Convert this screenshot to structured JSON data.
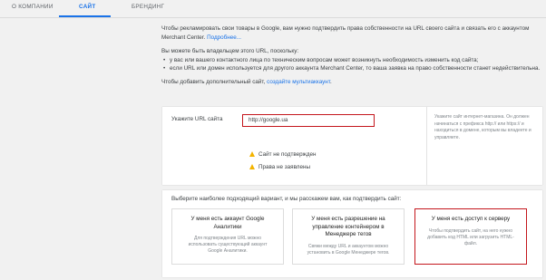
{
  "tabs": [
    {
      "label": "О КОМПАНИИ"
    },
    {
      "label": "САЙТ"
    },
    {
      "label": "БРЕНДИНГ"
    }
  ],
  "intro": {
    "line1": "Чтобы рекламировать свои товары в Google, вам нужно подтвердить права собственности на URL своего сайта и связать его с аккаунтом Merchant Center.",
    "line1_link": "Подробнее...",
    "line2": "Вы можете быть владельцем этого URL, поскольку:",
    "bullet1": "у вас или вашего контактного лица по техническим вопросам может возникнуть необходимость изменить код сайта;",
    "bullet2": "если URL или домен используется для другого аккаунта Merchant Center, то ваша заявка на право собственности станет недействительна.",
    "line3": "Чтобы добавить дополнительный сайт,",
    "line3_link": "создайте мультиаккаунт",
    "line3_end": "."
  },
  "url_card": {
    "label": "Укажите URL сайта",
    "value": "http://google.ua",
    "help": "Укажите сайт интернет-магазина. Он должен начинаться с префикса http:// или https:// и находиться в домене, которым вы владеете и управляете.",
    "status1": "Сайт не подтвержден",
    "status2": "Права не заявлены",
    "warning_color": "#f4b400"
  },
  "verify_card": {
    "prompt": "Выберите наиболее подходящий вариант, и мы расскажем вам, как подтвердить сайт:",
    "options": [
      {
        "title": "У меня есть аккаунт Google Аналитики",
        "desc": "Для подтверждения URL можно использовать существующий аккаунт Google Аналитики."
      },
      {
        "title": "У меня есть разрешение на управление контейнером в Менеджере тегов",
        "desc": "Свяжи между URL и аккаунтом можно установить в Google Менеджере тегов."
      },
      {
        "title": "У меня есть доступ к серверу",
        "desc": "Чтобы подтвердить сайт, на него нужно добавить код HTML или загрузить HTML-файл."
      }
    ]
  },
  "colors": {
    "accent": "#1a73e8",
    "highlight": "#c4161c"
  }
}
